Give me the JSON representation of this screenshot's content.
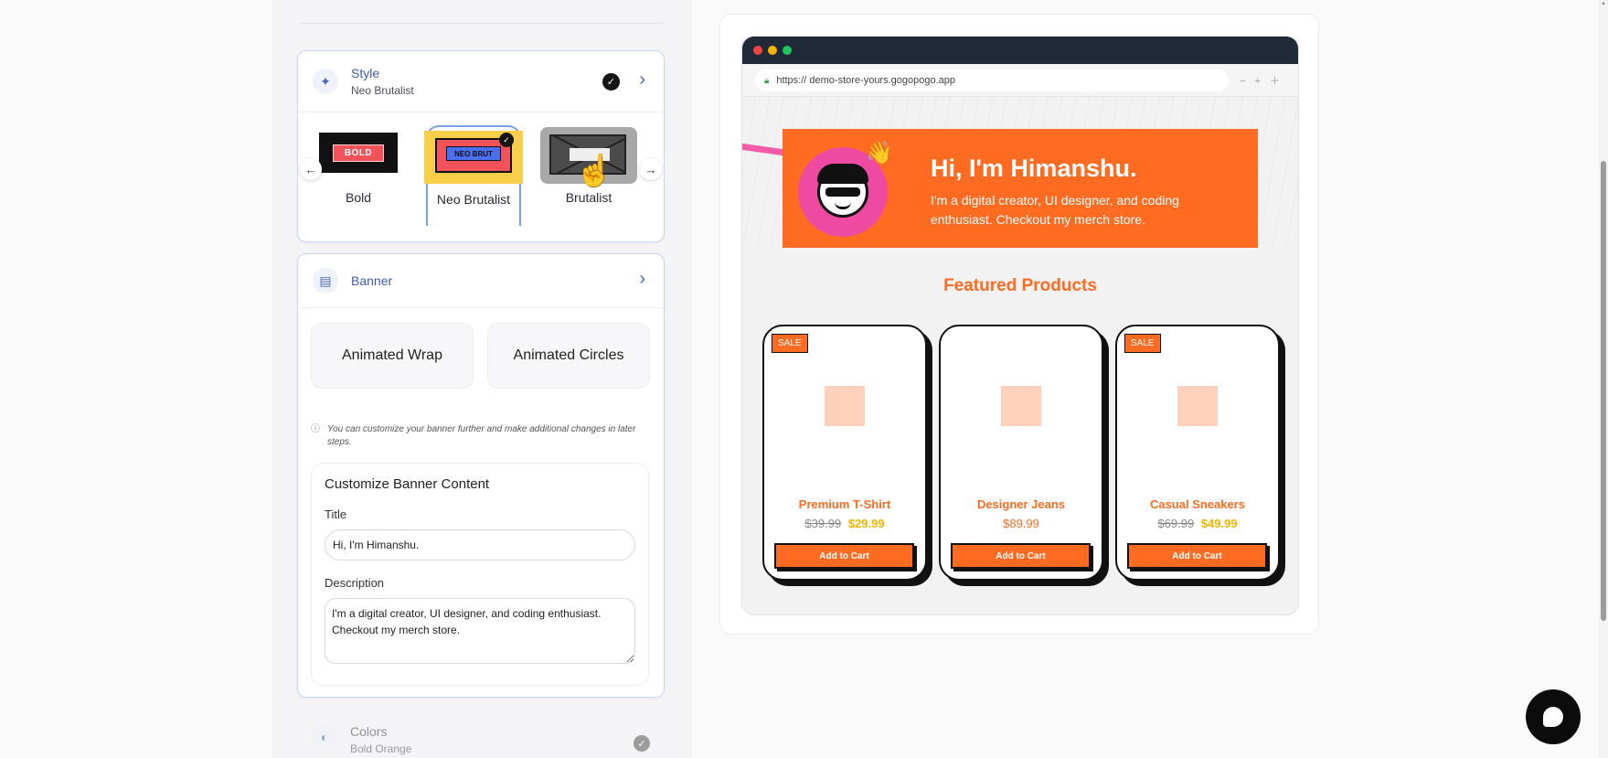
{
  "style_section": {
    "title": "Style",
    "subtitle": "Neo Brutalist",
    "options": [
      {
        "label": "Bold",
        "thumb_text": "BOLD"
      },
      {
        "label": "Neo Brutalist",
        "thumb_text": "NEO BRUT"
      },
      {
        "label": "Brutalist",
        "thumb_text": ""
      }
    ],
    "selected": "Neo Brutalist"
  },
  "banner_section": {
    "title": "Banner",
    "options": [
      "Animated Wrap",
      "Animated Circles"
    ],
    "note": "You can customize your banner further and make additional changes in later steps.",
    "customize": {
      "heading": "Customize Banner Content",
      "title_label": "Title",
      "title_value": "Hi, I'm Himanshu.",
      "description_label": "Description",
      "description_value": "I'm a digital creator, UI designer, and coding enthusiast. Checkout my merch store."
    }
  },
  "colors_section": {
    "title": "Colors",
    "subtitle": "Bold Orange"
  },
  "preview": {
    "url": "https:// demo-store-yours.gogopogo.app",
    "hero_title": "Hi, I'm Himanshu.",
    "hero_description": "I'm a digital creator, UI designer, and coding enthusiast. Checkout my merch store.",
    "featured_heading": "Featured Products",
    "products": [
      {
        "badge": "SALE",
        "name": "Premium T-Shirt",
        "old_price": "$39.99",
        "price": "$29.99",
        "button": "Add to Cart"
      },
      {
        "badge": "",
        "name": "Designer Jeans",
        "old_price": "",
        "price": "$89.99",
        "button": "Add to Cart"
      },
      {
        "badge": "SALE",
        "name": "Casual Sneakers",
        "old_price": "$69.99",
        "price": "$49.99",
        "button": "Add to Cart"
      }
    ]
  },
  "colors": {
    "accent": "#ff6b21",
    "sale_price": "#f5b400",
    "avatar_bg": "#ee4aa2",
    "link_blue": "#3f5cb0"
  },
  "icons": {
    "style": "sparkle-icon",
    "banner": "layout-icon",
    "colors": "palette-icon",
    "check": "check-icon",
    "chevron": "chevron-right-icon",
    "lock": "lock-icon",
    "chat": "chat-bubble-icon"
  }
}
